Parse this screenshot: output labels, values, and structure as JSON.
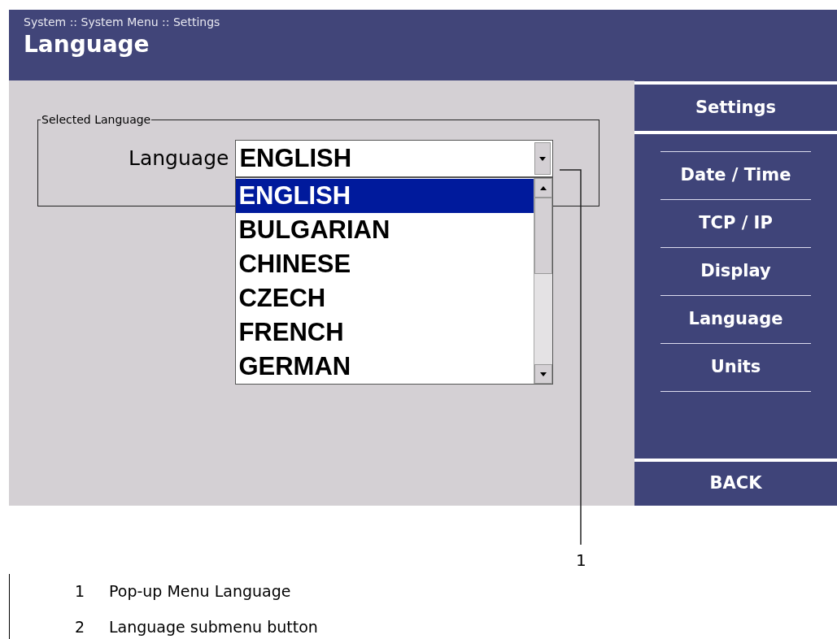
{
  "header": {
    "breadcrumb": "System :: System Menu :: Settings",
    "title": "Language"
  },
  "group": {
    "legend": "Selected Language",
    "label": "Language",
    "value": "ENGLISH",
    "options": [
      {
        "label": "ENGLISH",
        "selected": true
      },
      {
        "label": "BULGARIAN",
        "selected": false
      },
      {
        "label": "CHINESE",
        "selected": false
      },
      {
        "label": "CZECH",
        "selected": false
      },
      {
        "label": "FRENCH",
        "selected": false
      },
      {
        "label": "GERMAN",
        "selected": false
      }
    ]
  },
  "sidebar": {
    "title": "Settings",
    "items": [
      "Date / Time",
      "TCP / IP",
      "Display",
      "Language",
      "Units"
    ],
    "back": "BACK"
  },
  "callout": {
    "label": "1"
  },
  "key": [
    {
      "number": "1",
      "text": "Pop-up Menu Language"
    },
    {
      "number": "2",
      "text": "Language submenu button"
    }
  ]
}
